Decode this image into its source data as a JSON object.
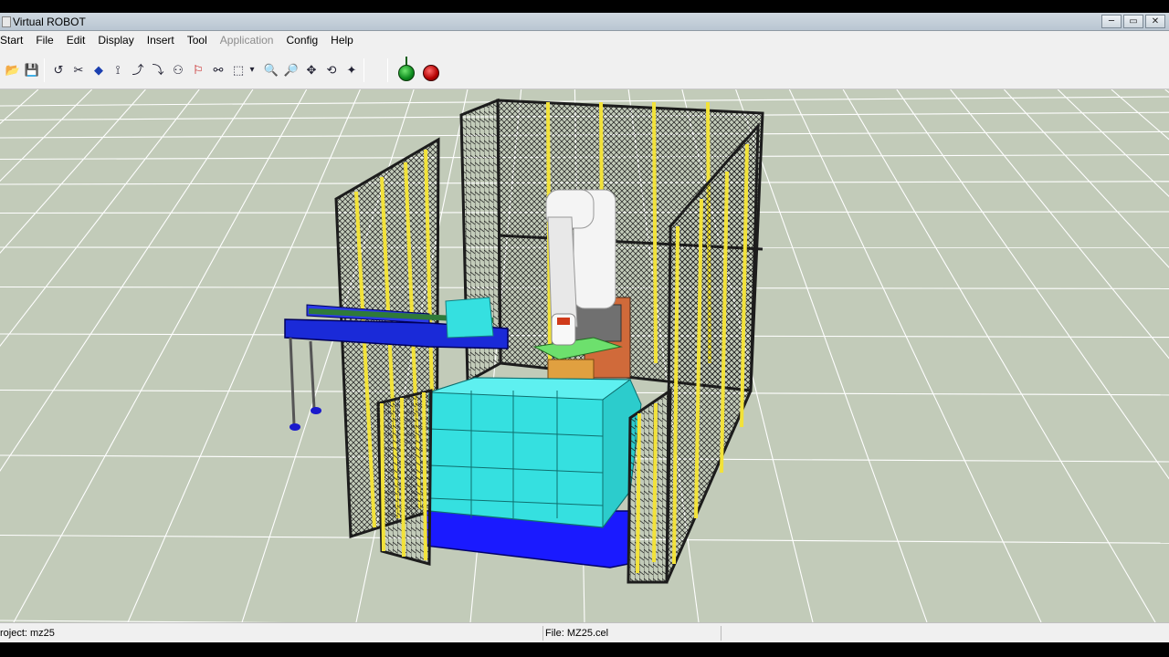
{
  "window": {
    "title": "Virtual ROBOT",
    "controls": {
      "minimize": "─",
      "maximize": "▭",
      "close": "✕"
    }
  },
  "menu": {
    "items": [
      {
        "label": "Start",
        "enabled": true
      },
      {
        "label": "File",
        "enabled": true
      },
      {
        "label": "Edit",
        "enabled": true
      },
      {
        "label": "Display",
        "enabled": true
      },
      {
        "label": "Insert",
        "enabled": true
      },
      {
        "label": "Tool",
        "enabled": true
      },
      {
        "label": "Application",
        "enabled": false
      },
      {
        "label": "Config",
        "enabled": true
      },
      {
        "label": "Help",
        "enabled": true
      }
    ]
  },
  "toolbar": {
    "buttons": [
      {
        "icon": "open-folder-icon",
        "glyph": "📂"
      },
      {
        "icon": "save-icon",
        "glyph": "💾"
      },
      {
        "icon": "undo-icon",
        "glyph": "↺"
      },
      {
        "icon": "cut-icon",
        "glyph": "✂"
      },
      {
        "icon": "insert-object-icon",
        "glyph": "◆"
      },
      {
        "icon": "robot-arm-icon",
        "glyph": "⟟"
      },
      {
        "icon": "robot-move-icon",
        "glyph": "⤴"
      },
      {
        "icon": "robot-path-icon",
        "glyph": "⤵"
      },
      {
        "icon": "gripper-icon",
        "glyph": "⚇"
      },
      {
        "icon": "tool-red-icon",
        "glyph": "⚐"
      },
      {
        "icon": "link-icon",
        "glyph": "⚯"
      },
      {
        "icon": "view-cube-icon",
        "glyph": "⬚"
      },
      {
        "icon": "dropdown-icon",
        "glyph": "▾"
      },
      {
        "icon": "zoom-icon",
        "glyph": "🔍"
      },
      {
        "icon": "zoom-window-icon",
        "glyph": "🔎"
      },
      {
        "icon": "pan-icon",
        "glyph": "✥"
      },
      {
        "icon": "rotate-view-icon",
        "glyph": "⟲"
      },
      {
        "icon": "fit-view-icon",
        "glyph": "✦"
      }
    ],
    "run_colors": {
      "start": "#1a9a2a",
      "stop": "#c40000"
    }
  },
  "viewport": {
    "floor_color": "#c2cbb9",
    "grid_color": "#ffffff",
    "fence_color": "#1c1c1c",
    "post_color": "#f2e23a",
    "box_color": "#35e0e0",
    "pallet_color": "#1a1aff",
    "conveyor_color": "#1a2ad8",
    "robot_color": "#f4f4f4",
    "pad_color": "#6de06d"
  },
  "status": {
    "project": "roject: mz25",
    "file": "File: MZ25.cel"
  }
}
